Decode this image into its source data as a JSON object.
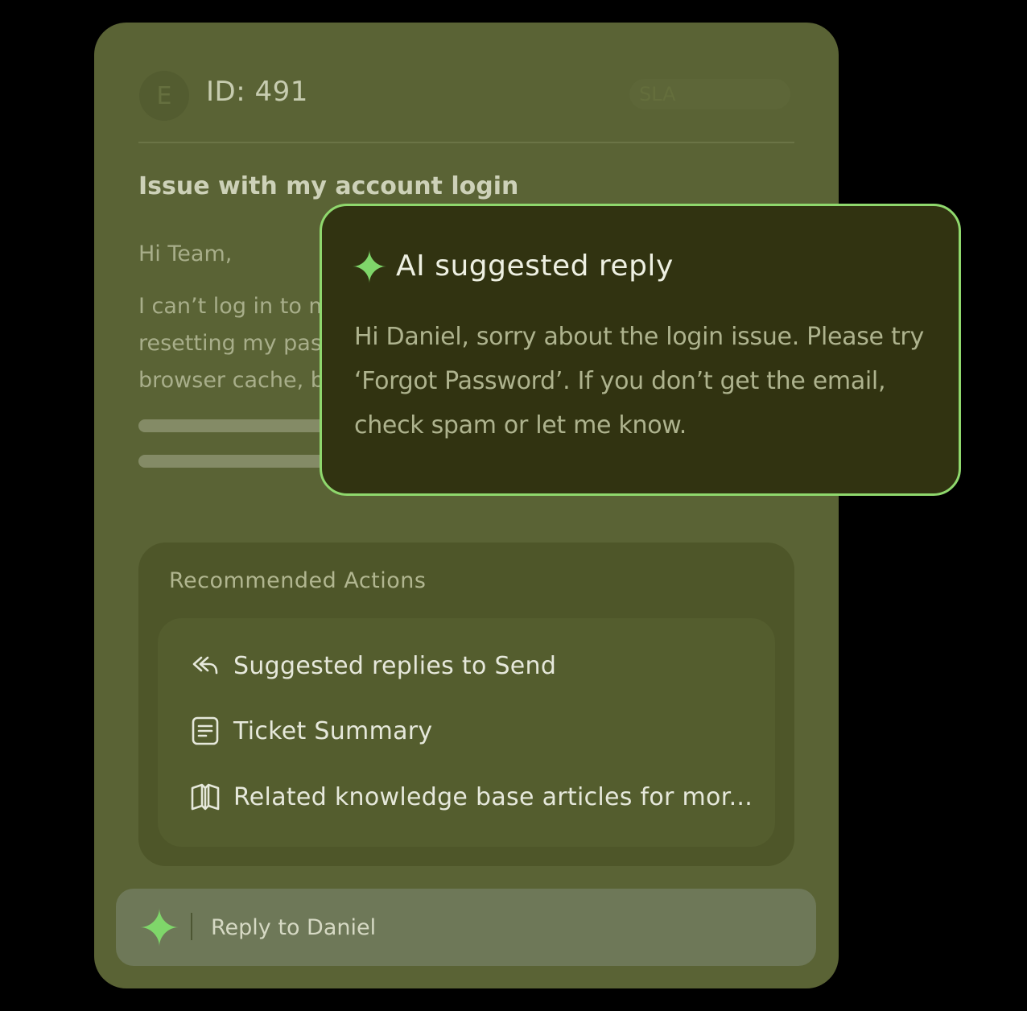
{
  "ticket": {
    "avatar_initial": "E",
    "id_label": "ID: 491",
    "sla_label": "SLA",
    "subject": "Issue with my account login",
    "greeting": "Hi Team,",
    "body": "I can’t log in to m\nresetting my pas\nbrowser cache, b"
  },
  "recommended_actions": {
    "title": "Recommended Actions",
    "items": [
      {
        "icon": "reply-icon",
        "label": "Suggested replies to Send"
      },
      {
        "icon": "document-icon",
        "label": "Ticket Summary"
      },
      {
        "icon": "book-icon",
        "label": "Related knowledge base articles for mor..."
      }
    ]
  },
  "reply_bar": {
    "icon": "sparkle-icon",
    "placeholder": "Reply to Daniel"
  },
  "ai_suggestion": {
    "icon": "sparkle-icon",
    "title": "AI suggested reply",
    "text": "Hi Daniel, sorry about the login issue. Please try ‘Forgot Password’. If you don’t get the email, check spam or let me know."
  },
  "colors": {
    "background": "#000000",
    "card": "#5a6335",
    "accent_green": "#7fd66a",
    "popup_border": "#8fd86d",
    "popup_bg": "#313311"
  }
}
